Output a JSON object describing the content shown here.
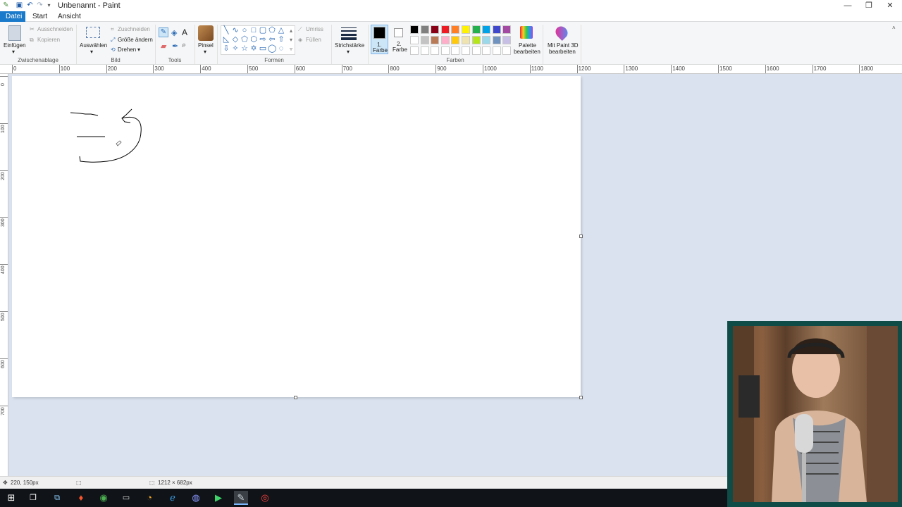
{
  "window": {
    "title": "Unbenannt - Paint",
    "controls": {
      "minimize": "—",
      "restore": "❐",
      "close": "✕"
    }
  },
  "tabs": [
    {
      "label": "Datei",
      "active": true
    },
    {
      "label": "Start",
      "active": false
    },
    {
      "label": "Ansicht",
      "active": false
    }
  ],
  "ribbon": {
    "clipboard": {
      "group": "Zwischenablage",
      "paste": "Einfügen",
      "cut": "Ausschneiden",
      "copy": "Kopieren"
    },
    "image": {
      "group": "Bild",
      "select": "Auswählen",
      "crop": "Zuschneiden",
      "resize": "Größe ändern",
      "rotate": "Drehen"
    },
    "tools": {
      "group": "Tools",
      "text_glyph": "A"
    },
    "brushes": {
      "label": "Pinsel"
    },
    "shapes": {
      "group": "Formen",
      "outline": "Umriss",
      "fill": "Füllen"
    },
    "stroke": {
      "label": "Strichstärke"
    },
    "colors": {
      "group": "Farben",
      "color1": {
        "label_line1": "1.",
        "label_line2": "Farbe",
        "value": "#000000"
      },
      "color2": {
        "label_line1": "2.",
        "label_line2": "Farbe",
        "value": "#ffffff"
      },
      "palette_row1": [
        "#000000",
        "#7f7f7f",
        "#880015",
        "#ed1c24",
        "#ff7f27",
        "#fff200",
        "#22b14c",
        "#00a2e8",
        "#3f48cc",
        "#a349a4"
      ],
      "palette_row2": [
        "#ffffff",
        "#c3c3c3",
        "#b97a57",
        "#ffaec9",
        "#ffc90e",
        "#efe4b0",
        "#b5e61d",
        "#99d9ea",
        "#7092be",
        "#c8bfe7"
      ],
      "edit_palette_line1": "Palette",
      "edit_palette_line2": "bearbeiten"
    },
    "paint3d": {
      "line1": "Mit Paint 3D",
      "line2": "bearbeiten"
    }
  },
  "ruler": {
    "horizontal": [
      "0",
      "100",
      "200",
      "300",
      "400",
      "500",
      "600",
      "700",
      "800",
      "900",
      "1000",
      "1100",
      "1200",
      "1300",
      "1400",
      "1500",
      "1600",
      "1700",
      "1800"
    ],
    "vertical": [
      "0",
      "100",
      "200",
      "300",
      "400",
      "500",
      "600",
      "700"
    ]
  },
  "status": {
    "cursor_position": "220, 150px",
    "canvas_size": "1212 × 682px"
  },
  "taskbar": {
    "apps": [
      "windows-icon",
      "task-view-icon",
      "app-icon",
      "brave-icon",
      "chrome-icon",
      "terminal-icon",
      "blender-icon",
      "edge-icon",
      "discord-icon",
      "media-icon",
      "paint-icon",
      "record-icon"
    ]
  }
}
